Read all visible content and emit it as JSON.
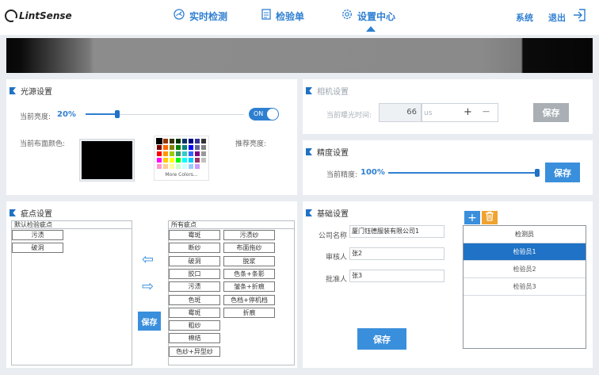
{
  "app": {
    "logo_text": "LintSense"
  },
  "nav": {
    "items": [
      {
        "label": "实时检测",
        "icon": "gauge-icon"
      },
      {
        "label": "检验单",
        "icon": "document-icon"
      },
      {
        "label": "设置中心",
        "icon": "gear-icon",
        "active": true
      }
    ],
    "system_label": "系统",
    "exit_label": "退出"
  },
  "light": {
    "title": "光源设置",
    "brightness_label": "当前亮度:",
    "brightness_value": "20%",
    "brightness_level": 0.2,
    "toggle_label": "ON",
    "fabric_color_label": "当前布面颜色:",
    "fabric_color": "#000000",
    "recommend_label": "推荐亮度:",
    "more_colors": "More Colors...",
    "palette": [
      "#000000",
      "#993300",
      "#333300",
      "#003300",
      "#003366",
      "#000080",
      "#333399",
      "#333333",
      "#800000",
      "#ff6600",
      "#808000",
      "#008000",
      "#008080",
      "#0000ff",
      "#666699",
      "#808080",
      "#ff0000",
      "#ff9900",
      "#99cc00",
      "#339966",
      "#33cccc",
      "#3366ff",
      "#800080",
      "#999999",
      "#ff00ff",
      "#ffcc00",
      "#ffff00",
      "#00ff00",
      "#00ffff",
      "#00ccff",
      "#993366",
      "#c0c0c0",
      "#ff99cc",
      "#ffcc99",
      "#ffff99",
      "#ccffcc",
      "#ccffff",
      "#99ccff",
      "#cc99ff",
      "#ffffff"
    ]
  },
  "camera": {
    "title": "相机设置",
    "exposure_label": "当前曝光时间:",
    "exposure_value": "66",
    "exposure_unit": "us",
    "plus": "+",
    "minus": "—",
    "save_label": "保存"
  },
  "precision": {
    "title": "精度设置",
    "label": "当前精度:",
    "value": "100%",
    "level": 1.0,
    "save_label": "保存"
  },
  "defects": {
    "title": "疵点设置",
    "default_header": "默认检验疵点",
    "default_items": [
      "污渍",
      "破洞"
    ],
    "all_header": "所有疵点",
    "all_col1": [
      "霉斑",
      "断纱",
      "破洞",
      "胶口",
      "污渍",
      "色斑",
      "霉斑",
      "粗纱",
      "棉结",
      "色纱+异型纱"
    ],
    "all_col2": [
      "污渍纱",
      "布面拖纱",
      "脱浆",
      "色条+条影",
      "皱条+折痕",
      "色档+停机档",
      "折痕"
    ],
    "left_arrow": "⇦",
    "right_arrow": "⇨",
    "save_label": "保存"
  },
  "basic": {
    "title": "基础设置",
    "company_label": "公司名称",
    "company_value": "厦门钰德服装有限公司1",
    "reviewer_label": "审核人",
    "reviewer_value": "张2",
    "approver_label": "批准人",
    "approver_value": "张3",
    "save_label": "保存",
    "add_label": "+",
    "inspector_header": "检测员",
    "inspectors": [
      "检验员1",
      "检验员2",
      "检验员3"
    ],
    "selected_index": 0
  }
}
